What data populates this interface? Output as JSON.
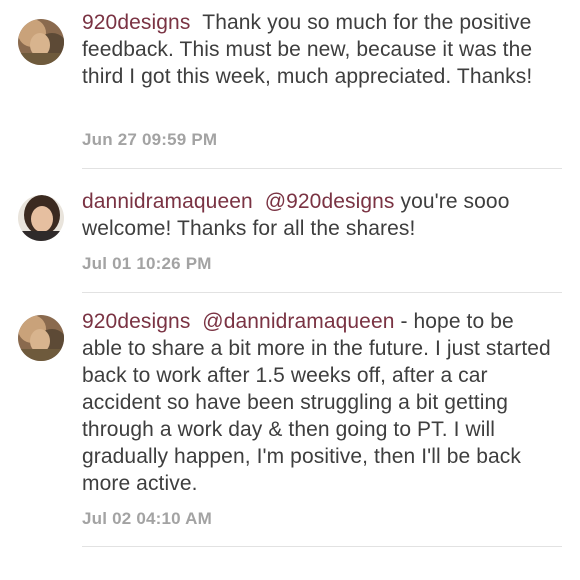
{
  "comments": [
    {
      "username": "920designs",
      "mention": "",
      "text": "Thank you so much for the positive feedback.  This must be new, because it was the third I got this week, much appreciated.  Thanks!",
      "timestamp": "Jun 27 09:59 PM",
      "avatar": "user-avatar-920designs"
    },
    {
      "username": "dannidramaqueen",
      "mention": "@920designs",
      "text": "you're sooo welcome! Thanks for all the shares!",
      "timestamp": "Jul 01 10:26 PM",
      "avatar": "user-avatar-dannidramaqueen"
    },
    {
      "username": "920designs",
      "mention": "@dannidramaqueen",
      "text": "- hope to be able to share a bit more in the future.  I just started back to work after 1.5 weeks off, after a car accident so have been struggling a bit getting through a work day & then going to PT.  I will gradually happen, I'm positive, then I'll be back more active.",
      "timestamp": "Jul 02 04:10 AM",
      "avatar": "user-avatar-920designs"
    }
  ],
  "colors": {
    "username": "#7a3343",
    "text": "#3e3e3e",
    "timestamp": "#a3a3a3",
    "divider": "#e2e2e2"
  }
}
